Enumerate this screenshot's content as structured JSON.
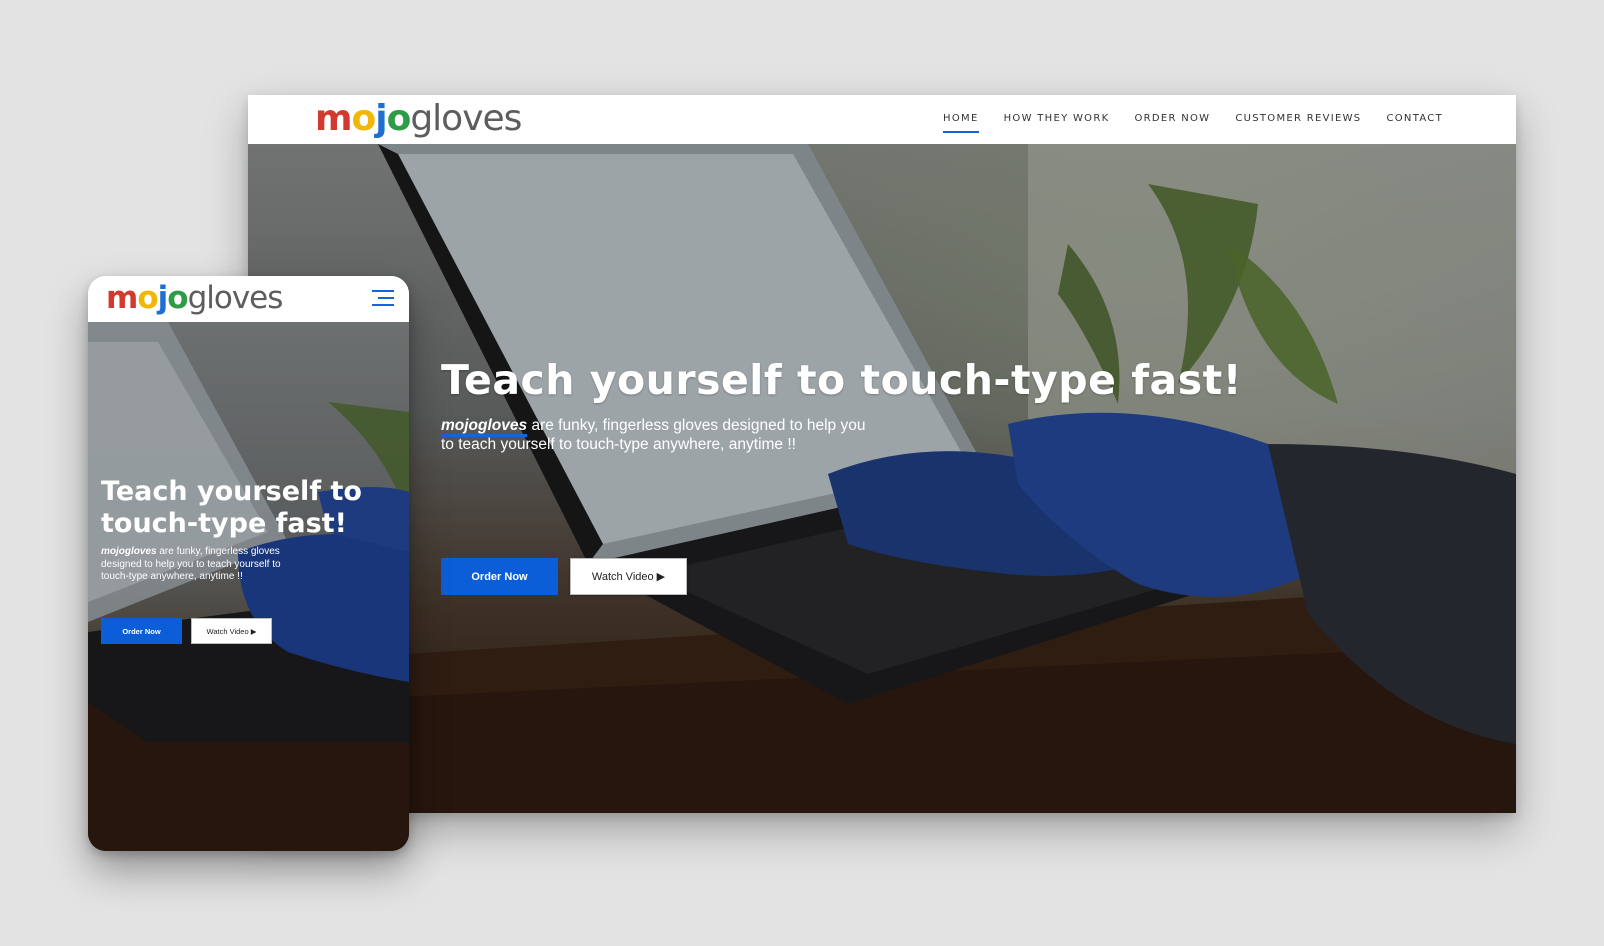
{
  "brand": {
    "logo_m": "m",
    "logo_o1": "o",
    "logo_j": "j",
    "logo_o2": "o",
    "logo_rest": "gloves",
    "colors": {
      "m": "#d23a2f",
      "o1": "#f2b705",
      "j": "#1f6fd1",
      "o2": "#2e9b47",
      "rest": "#5d5d5d",
      "accent": "#0b5ed7"
    }
  },
  "nav": {
    "items": [
      {
        "label": "HOME",
        "active": true
      },
      {
        "label": "HOW THEY WORK",
        "active": false
      },
      {
        "label": "ORDER NOW",
        "active": false
      },
      {
        "label": "CUSTOMER REVIEWS",
        "active": false
      },
      {
        "label": "CONTACT",
        "active": false
      }
    ]
  },
  "hero": {
    "title": "Teach yourself to touch-type fast!",
    "brand_word": "mojogloves",
    "subtitle_desktop": " are funky, fingerless gloves designed to help you to teach yourself to touch-type anywhere, anytime !!",
    "subtitle_mobile": " are funky, fingerless gloves designed to help you to teach yourself to touch-type anywhere, anytime !!",
    "order_label": "Order Now",
    "video_label": "Watch Video ▶"
  },
  "mobile": {
    "menu_icon": "hamburger-icon"
  }
}
